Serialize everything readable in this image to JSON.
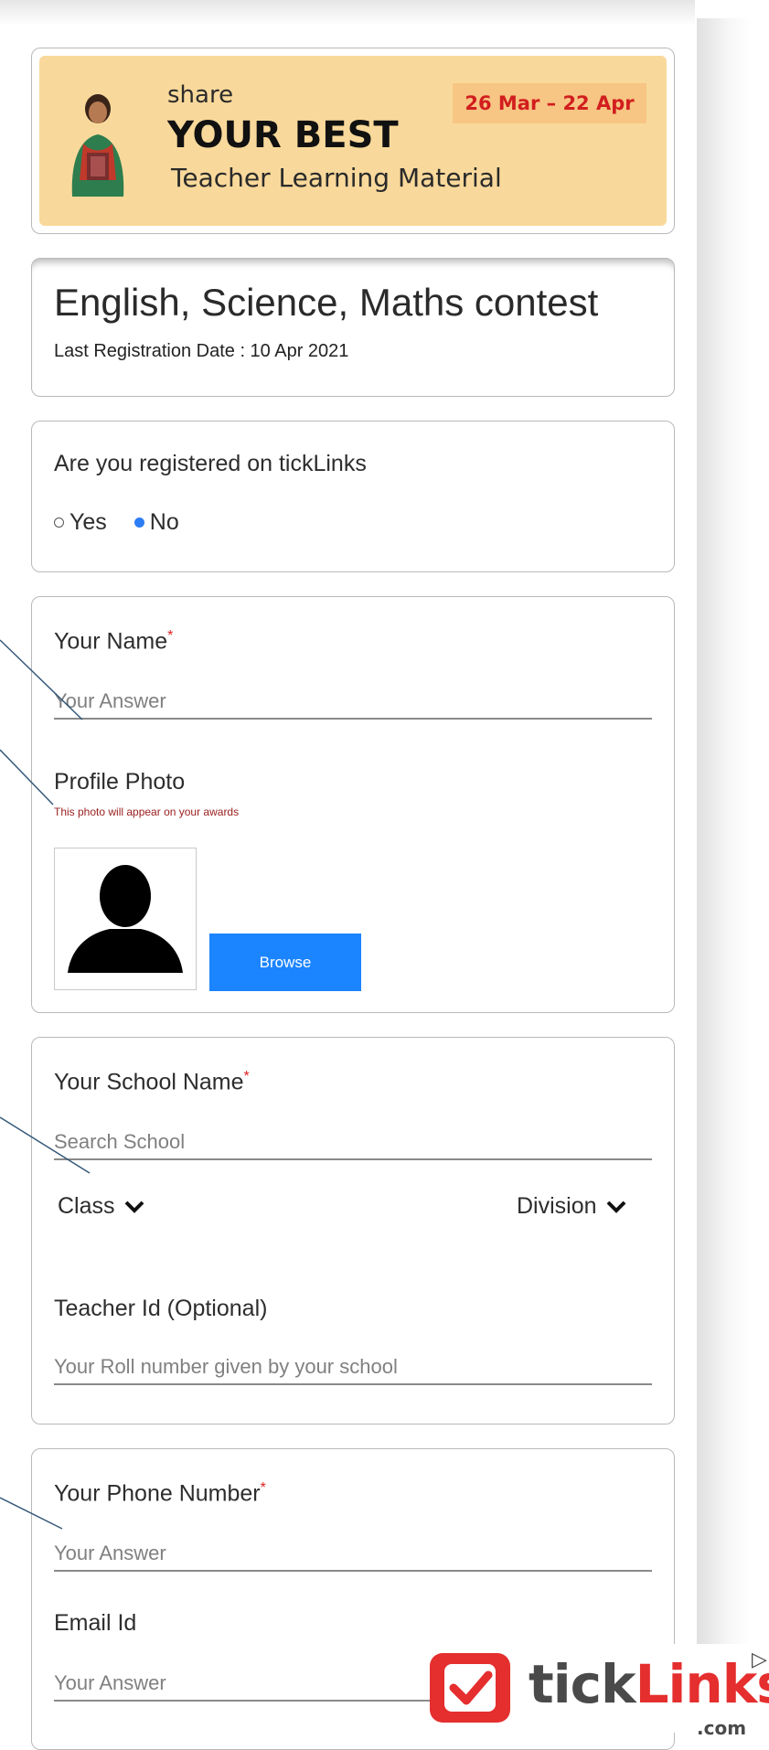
{
  "banner": {
    "share": "share",
    "headline": "YOUR BEST",
    "subtitle": "Teacher Learning Material",
    "date_range": "26 Mar – 22 Apr"
  },
  "contest": {
    "title": "English, Science, Maths contest",
    "last_registration": "Last Registration Date : 10 Apr 2021"
  },
  "registration": {
    "question": "Are you registered on tickLinks",
    "options": [
      "Yes",
      "No"
    ],
    "selected": "No"
  },
  "personal": {
    "name_label": "Your Name",
    "required_mark": "*",
    "name_placeholder": "Your Answer",
    "photo_label": "Profile Photo",
    "photo_note": "This photo will appear on your awards",
    "browse_label": "Browse"
  },
  "school": {
    "school_label": "Your School Name",
    "school_placeholder": "Search School",
    "class_label": "Class",
    "division_label": "Division",
    "teacher_id_label": "Teacher Id (Optional)",
    "teacher_id_placeholder": "Your Roll number given by your school"
  },
  "contact": {
    "phone_label": "Your Phone Number",
    "phone_placeholder": "Your Answer",
    "email_label": "Email Id",
    "email_placeholder": "Your Answer"
  },
  "logo": {
    "tick": "tick",
    "links": "Links",
    "com": ".com"
  },
  "colors": {
    "banner_bg": "#f9d99b",
    "date_bg": "#f7c584",
    "date_text": "#d21e1e",
    "accent_blue": "#1b84ff",
    "required_red": "#e02020",
    "brand_red": "#e52e2e"
  }
}
